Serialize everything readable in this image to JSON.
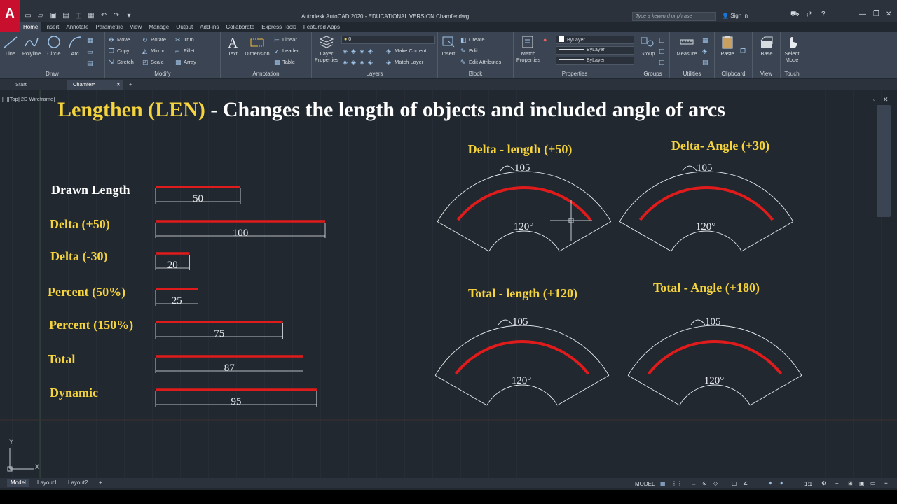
{
  "window": {
    "title": "Autodesk AutoCAD 2020 - EDUCATIONAL VERSION    Chamfer.dwg",
    "search_placeholder": "Type a keyword or phrase",
    "sign_in": "Sign In",
    "logo": "A"
  },
  "ribbon_tabs": [
    "Home",
    "Insert",
    "Annotate",
    "Parametric",
    "View",
    "Manage",
    "Output",
    "Add-ins",
    "Collaborate",
    "Express Tools",
    "Featured Apps"
  ],
  "ribbon": {
    "draw": {
      "label": "Draw",
      "tools": [
        "Line",
        "Polyline",
        "Circle",
        "Arc"
      ]
    },
    "modify": {
      "label": "Modify",
      "rows": [
        [
          "Move",
          "Rotate",
          "Trim"
        ],
        [
          "Copy",
          "Mirror",
          "Fillet"
        ],
        [
          "Stretch",
          "Scale",
          "Array"
        ]
      ]
    },
    "annotation": {
      "label": "Annotation",
      "text": "Text",
      "dimension": "Dimension",
      "linear": "Linear",
      "leader": "Leader",
      "table": "Table"
    },
    "layers": {
      "label": "Layers",
      "layer_properties": "Layer Properties",
      "layer_value": "0",
      "make_current": "Make Current",
      "match_layer": "Match Layer"
    },
    "block": {
      "label": "Block",
      "insert": "Insert",
      "create": "Create",
      "edit": "Edit",
      "edit_attributes": "Edit Attributes"
    },
    "properties": {
      "label": "Properties",
      "match": "Match Properties",
      "bylayer": "ByLayer"
    },
    "groups": {
      "label": "Groups",
      "group": "Group"
    },
    "utilities": {
      "label": "Utilities",
      "measure": "Measure"
    },
    "clipboard": {
      "label": "Clipboard",
      "paste": "Paste"
    },
    "view": {
      "label": "View",
      "base": "Base"
    },
    "touch": {
      "label": "Touch",
      "select_mode": "Select Mode"
    }
  },
  "file_tabs": [
    "Start",
    "Chamfer*"
  ],
  "viewport_label": "[−][Top][2D Wireframe]",
  "drawing": {
    "title_highlight": "Lengthen (LEN)",
    "title_rest": " - Changes the length of objects and included angle of arcs",
    "lines": [
      {
        "label": "Drawn Length",
        "value": "50",
        "len": 50
      },
      {
        "label": "Delta (+50)",
        "value": "100",
        "len": 100
      },
      {
        "label": "Delta (-30)",
        "value": "20",
        "len": 20
      },
      {
        "label": "Percent (50%)",
        "value": "25",
        "len": 25
      },
      {
        "label": "Percent (150%)",
        "value": "75",
        "len": 75
      },
      {
        "label": "Total",
        "value": "87",
        "len": 87
      },
      {
        "label": "Dynamic",
        "value": "95",
        "len": 95
      }
    ],
    "arcs": [
      {
        "title": "Delta - length (+50)",
        "arc_len": "105",
        "angle": "120°"
      },
      {
        "title": "Delta- Angle (+30)",
        "arc_len": "105",
        "angle": "120°"
      },
      {
        "title": "Total - length (+120)",
        "arc_len": "105",
        "angle": "120°"
      },
      {
        "title": "Total - Angle (+180)",
        "arc_len": "105",
        "angle": "120°"
      }
    ],
    "ucs": {
      "x": "X",
      "y": "Y"
    }
  },
  "layout_tabs": [
    "Model",
    "Layout1",
    "Layout2"
  ],
  "status": {
    "model": "MODEL",
    "scale": "1:1"
  },
  "colors": {
    "title_yellow": "#f5d33d",
    "line_red": "#e01b1b",
    "bg": "#212830"
  }
}
